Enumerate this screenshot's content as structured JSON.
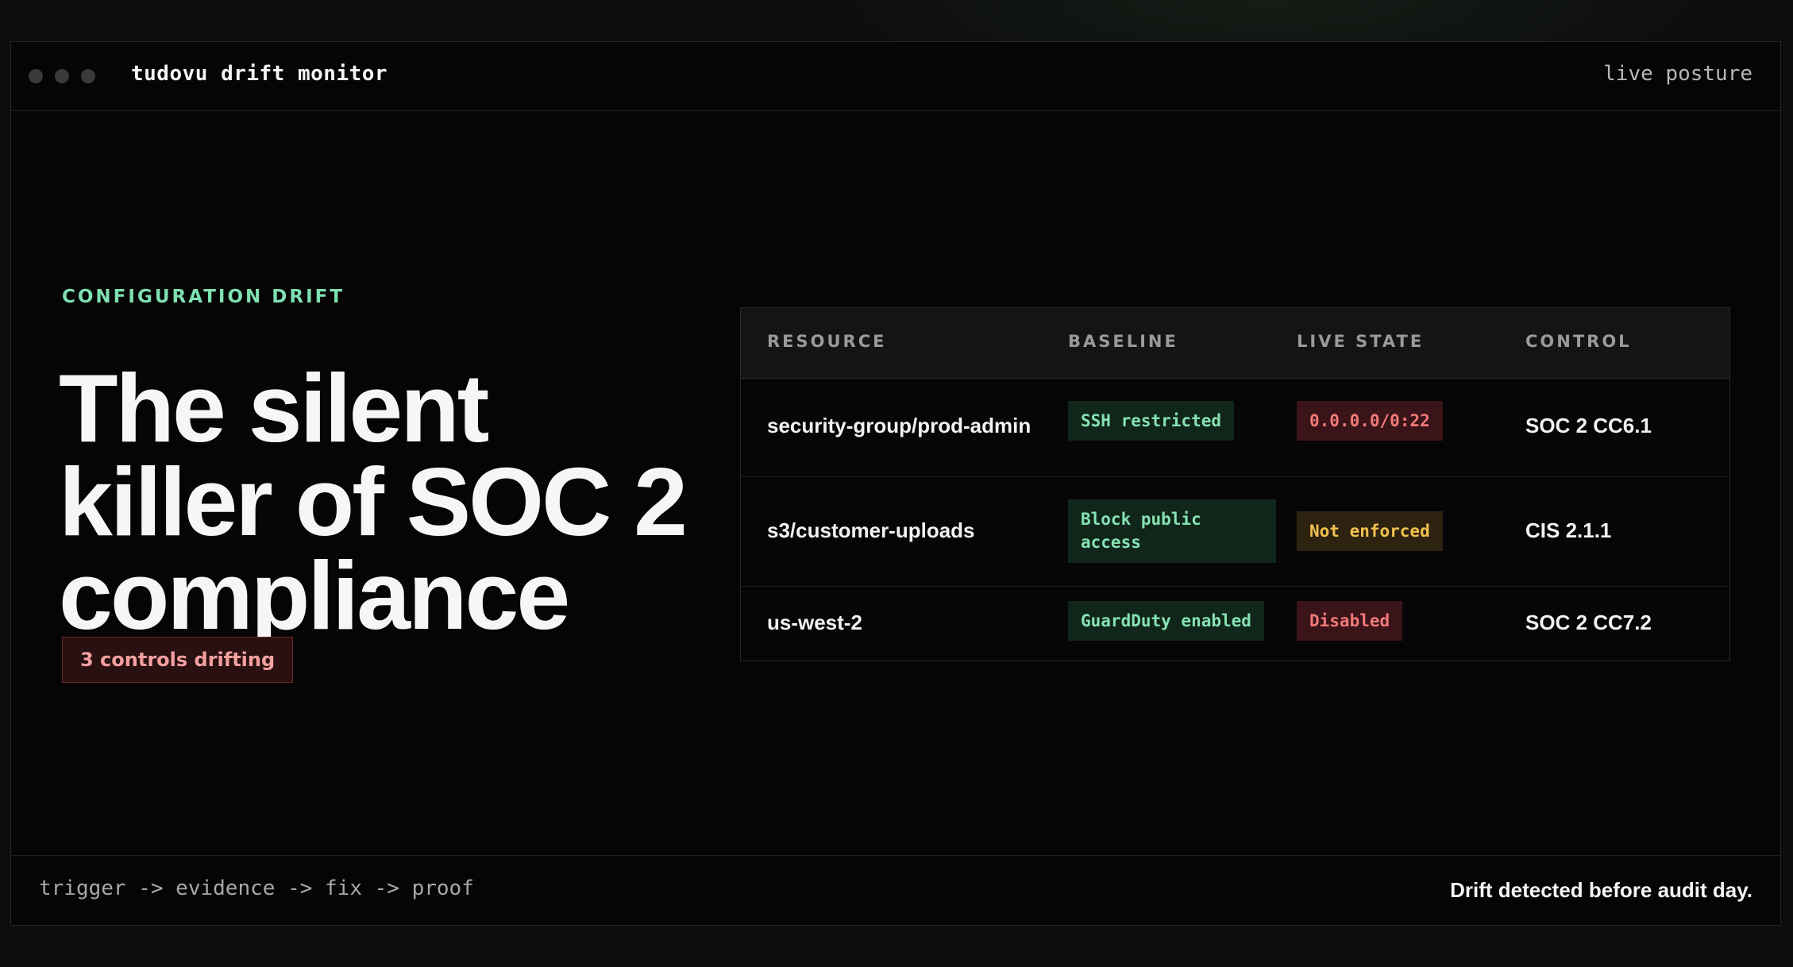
{
  "window": {
    "app_title": "tudovu drift monitor",
    "status_label": "live posture"
  },
  "hero": {
    "eyebrow": "CONFIGURATION DRIFT",
    "headline_lines": [
      "The silent",
      "killer of SOC 2",
      "compliance"
    ],
    "badge": "3 controls drifting"
  },
  "table": {
    "columns": [
      "RESOURCE",
      "BASELINE",
      "LIVE STATE",
      "CONTROL"
    ],
    "rows": [
      {
        "resource": "security-group/prod-admin",
        "baseline": "SSH restricted",
        "live_state": "0.0.0.0/0:22",
        "live_status": "red",
        "control": "SOC 2 CC6.1"
      },
      {
        "resource": "s3/customer-uploads",
        "baseline": "Block public access",
        "live_state": "Not enforced",
        "live_status": "yellow",
        "control": "CIS 2.1.1"
      },
      {
        "resource": "us-west-2",
        "baseline": "GuardDuty enabled",
        "live_state": "Disabled",
        "live_status": "red",
        "control": "SOC 2 CC7.2"
      }
    ]
  },
  "footer": {
    "pipeline": "trigger -> evidence -> fix -> proof",
    "tagline": "Drift detected before audit day."
  },
  "colors": {
    "accent_green": "#7fe0b0",
    "alert_red": "#f27a7a",
    "warning_yellow": "#f2c250",
    "background": "#050505"
  }
}
